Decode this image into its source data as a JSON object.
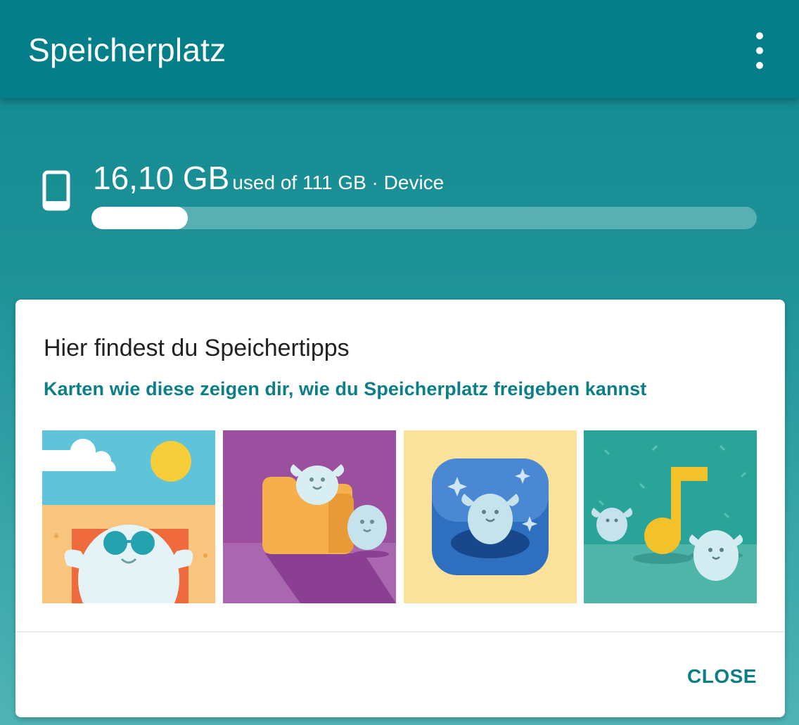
{
  "appbar": {
    "title": "Speicherplatz",
    "menu_icon": "more-vert-icon"
  },
  "storage": {
    "icon": "smartphone-icon",
    "used_amount": "16,10 GB",
    "used_detail": "used of 111 GB · Device",
    "used_fraction": 0.145
  },
  "tips_card": {
    "title": "Hier findest du Speichertipps",
    "subtitle": "Karten wie diese zeigen dir, wie du Speicherplatz freigeben kannst",
    "illustrations": [
      "beach-character-illustration",
      "folder-characters-illustration",
      "app-icon-character-illustration",
      "music-characters-illustration"
    ],
    "close_label": "CLOSE"
  },
  "colors": {
    "appbar": "#047f89",
    "accent_text": "#0c7f86",
    "background": "#1e9398"
  }
}
